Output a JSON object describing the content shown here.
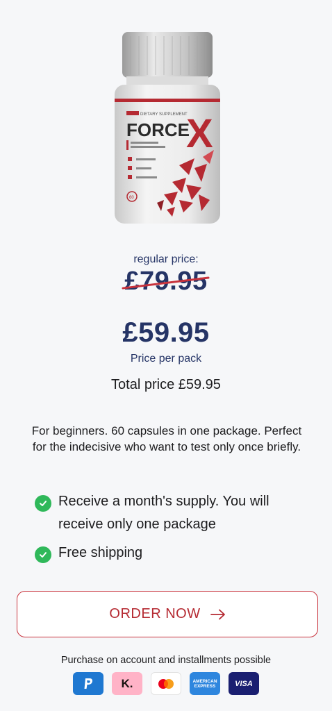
{
  "product": {
    "brand": "FORCE",
    "brand_x": "X",
    "subtitle": "DIETARY SUPPLEMENT",
    "capsules": "60"
  },
  "pricing": {
    "regular_label": "regular price:",
    "old_price": "£79.95",
    "new_price": "£59.95",
    "per_pack": "Price per pack",
    "total": "Total price £59.95"
  },
  "description": "For beginners. 60 capsules in one package. Perfect for the indecisive who want to test only once briefly.",
  "features": [
    "Receive a month's supply. You will receive only one package",
    "Free shipping"
  ],
  "order_button": {
    "label": "ORDER NOW"
  },
  "installments": "Purchase on account and installments possible",
  "payments": {
    "klarna": "K.",
    "amex": "AMERICAN EXPRESS",
    "visa": "VISA"
  },
  "colors": {
    "accent": "#c8323c",
    "price_blue": "#253466",
    "check_green": "#2fb85a"
  }
}
